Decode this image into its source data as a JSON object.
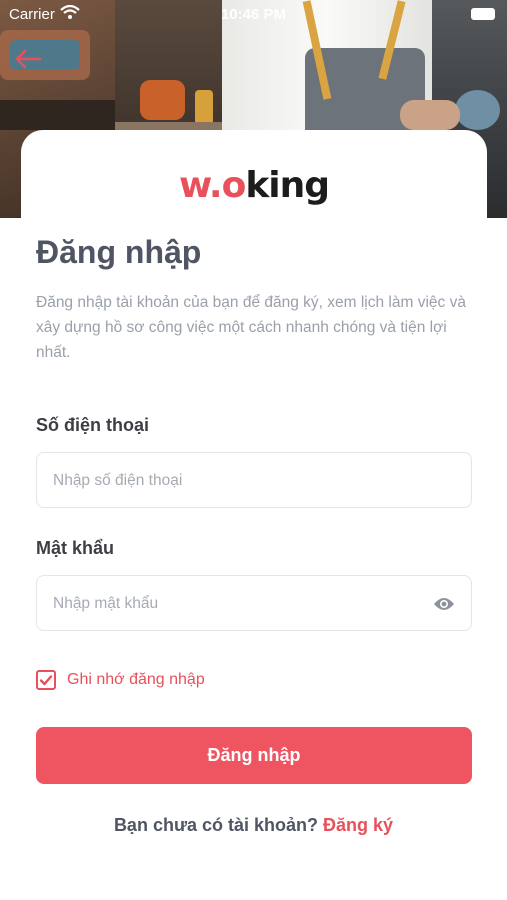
{
  "status_bar": {
    "carrier": "Carrier",
    "time": "10:46 PM"
  },
  "logo": {
    "w": "w",
    "dot": ".",
    "o": "o",
    "rest": "king"
  },
  "login": {
    "title": "Đăng nhập",
    "description": "Đăng nhập tài khoản của bạn để đăng ký, xem lịch làm việc và xây dựng hồ sơ công việc một cách nhanh chóng và tiện lợi nhất.",
    "phone_label": "Số điện thoại",
    "phone_placeholder": "Nhập số điện thoại",
    "phone_value": "",
    "password_label": "Mật khẩu",
    "password_placeholder": "Nhập mật khẩu",
    "password_value": "",
    "remember_label": "Ghi nhớ đăng nhập",
    "remember_checked": true,
    "submit_label": "Đăng nhập",
    "signup_prompt": "Bạn chưa có tài khoản?",
    "signup_link": "Đăng ký"
  },
  "icons": {
    "back": "back-arrow-icon",
    "wifi": "wifi-icon",
    "battery": "battery-icon",
    "eye": "eye-icon",
    "check": "checkmark-icon"
  },
  "colors": {
    "accent": "#e8505b",
    "button": "#ee5561",
    "title": "#4f5563",
    "muted": "#9aa0aa"
  }
}
